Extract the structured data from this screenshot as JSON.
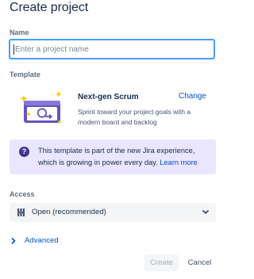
{
  "title": "Create project",
  "name_field": {
    "label": "Name",
    "placeholder": "Enter a project name",
    "value": ""
  },
  "template_field": {
    "label": "Template",
    "name": "Next-gen Scrum",
    "change_label": "Change",
    "description": "Sprint toward your project goals with a modern board and backlog"
  },
  "info_banner": {
    "text": "This template is part of the new Jira experience, which is growing in power every day.",
    "link": "Learn more"
  },
  "access_field": {
    "label": "Access",
    "selected": "Open (recommended)"
  },
  "advanced": {
    "label": "Advanced"
  },
  "buttons": {
    "create": "Create",
    "cancel": "Cancel"
  },
  "colors": {
    "focus_border": "#4c9aff",
    "link": "#0052cc",
    "banner_bg": "#eae6ff",
    "banner_icon": "#403294",
    "illustration_purple": "#6554c0",
    "illustration_star": "#ffc400",
    "select_bg": "#f4f5f7"
  }
}
